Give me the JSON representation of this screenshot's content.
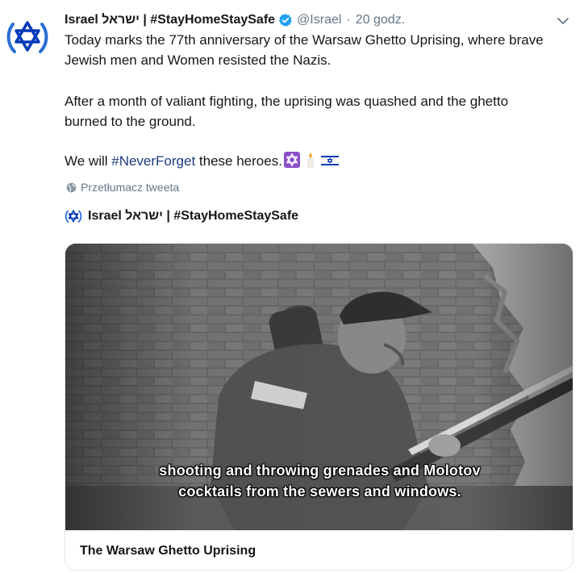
{
  "tweet": {
    "author": {
      "display_name": "Israel ישראל | #StayHomeStaySafe",
      "verified": true,
      "handle": "@Israel",
      "separator": "·",
      "time": "20 godz."
    },
    "body": {
      "line1": "Today marks the 77th anniversary of the Warsaw Ghetto Uprising, where brave",
      "line2": "Jewish men and Women resisted the Nazis.",
      "line3": "After a month of valiant fighting, the uprising was quashed and the ghetto",
      "line4": "burned to the ground.",
      "line5_prefix": "We will ",
      "line5_hashtag": "#NeverForget",
      "line5_suffix": " these heroes."
    },
    "emojis": [
      "star-of-david-emoji",
      "candle-emoji",
      "israel-flag-emoji"
    ],
    "translate_label": "Przetłumacz tweeta",
    "embed": {
      "author_name": "Israel ישראל | #StayHomeStaySafe",
      "video": {
        "subtitle_line1": "shooting and throwing grenades and Molotov",
        "subtitle_line2": "cocktails from the sewers and windows."
      },
      "card_title": "The Warsaw Ghetto Uprising"
    }
  },
  "colors": {
    "text": "#14171a",
    "secondary": "#657786",
    "hashtag": "#1b3a7a",
    "verified": "#1da1f2",
    "israel_blue": "#0038b8",
    "border": "#e1e8ed"
  }
}
